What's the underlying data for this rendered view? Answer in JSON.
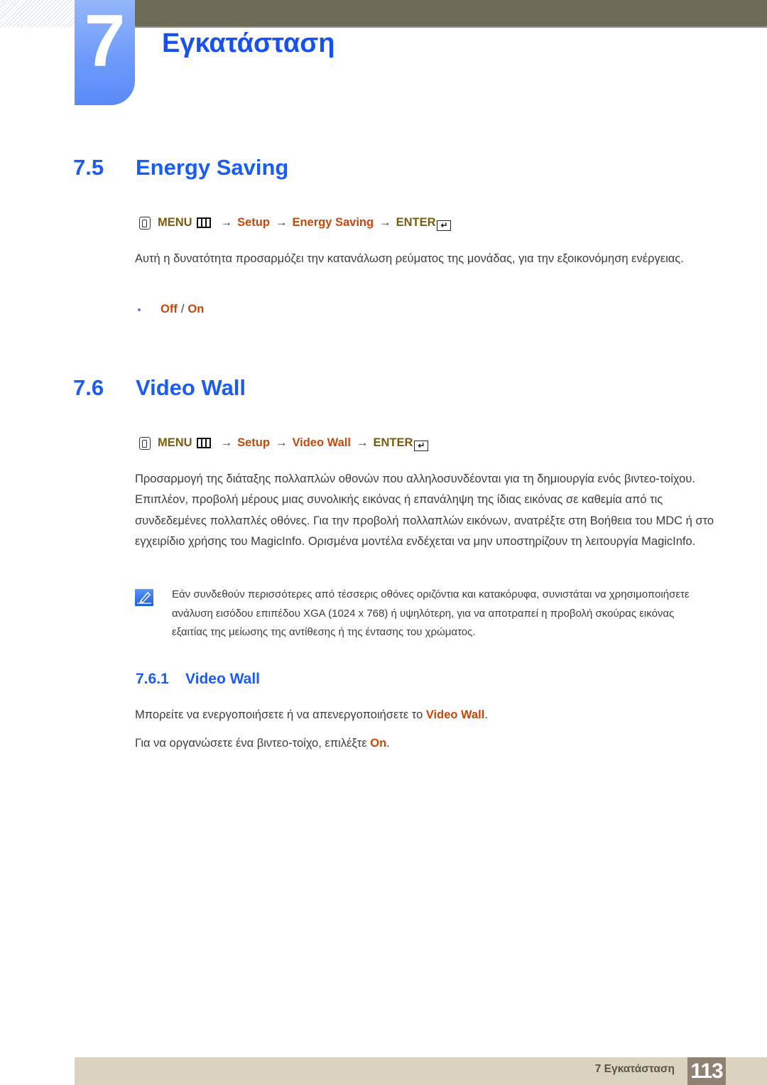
{
  "header": {
    "chapter_number": "7",
    "chapter_title": "Εγκατάσταση"
  },
  "section_energy": {
    "number": "7.5",
    "title": "Energy Saving",
    "path": {
      "menu": "MENU",
      "arrow": "→",
      "setup": "Setup",
      "item": "Energy Saving",
      "enter": "ENTER",
      "icons": [
        "hand-remote-icon",
        "menu-grid-icon",
        "enter-icon"
      ]
    },
    "description": "Αυτή η δυνατότητα προσαρμόζει την κατανάλωση ρεύματος της μονάδας, για την εξοικονόμηση ενέργειας.",
    "options": {
      "off": "Off",
      "separator": "/",
      "on": "On"
    }
  },
  "section_videowall": {
    "number": "7.6",
    "title": "Video Wall",
    "path": {
      "menu": "MENU",
      "arrow": "→",
      "setup": "Setup",
      "item": "Video Wall",
      "enter": "ENTER"
    },
    "description": "Προσαρμογή της διάταξης πολλαπλών οθονών που αλληλοσυνδέονται για τη δημιουργία ενός βιντεο-τοίχου. Επιπλέον, προβολή μέρους μιας συνολικής εικόνας ή επανάληψη της ίδιας εικόνας σε καθεμία από τις συνδεδεμένες πολλαπλές οθόνες. Για την προβολή πολλαπλών εικόνων, ανατρέξτε στη Βοήθεια του MDC ή στο εγχειρίδιο χρήσης του MagicInfo. Ορισμένα μοντέλα ενδέχεται να μην υποστηρίζουν τη λειτουργία MagicInfo.",
    "note": "Εάν συνδεθούν περισσότερες από τέσσερις οθόνες οριζόντια και κατακόρυφα, συνιστάται να χρησιμοποιήσετε ανάλυση εισόδου επιπέδου XGA (1024 x 768) ή υψηλότερη, για να αποτραπεί η προβολή σκούρας εικόνας εξαιτίας της μείωσης της αντίθεσης ή της έντασης του χρώματος.",
    "subsection": {
      "number": "7.6.1",
      "title": "Video Wall",
      "line1_prefix": "Μπορείτε να ενεργοποιήσετε ή να απενεργοποιήσετε το ",
      "line1_highlight": "Video Wall",
      "line1_suffix": ".",
      "line2_prefix": "Για να οργανώσετε ένα βιντεο-τοίχο, επιλέξτε ",
      "line2_highlight": "On",
      "line2_suffix": "."
    }
  },
  "footer": {
    "chapter_label": "7 Εγκατάσταση",
    "page_number": "113"
  },
  "colors": {
    "heading_blue": "#1a5cf5",
    "menu_item_orange": "#c8480a",
    "menu_brown": "#7b5b0f",
    "top_bar": "#6d6b57",
    "footer_bar": "#d9d3bf",
    "page_box": "#8f8273"
  }
}
